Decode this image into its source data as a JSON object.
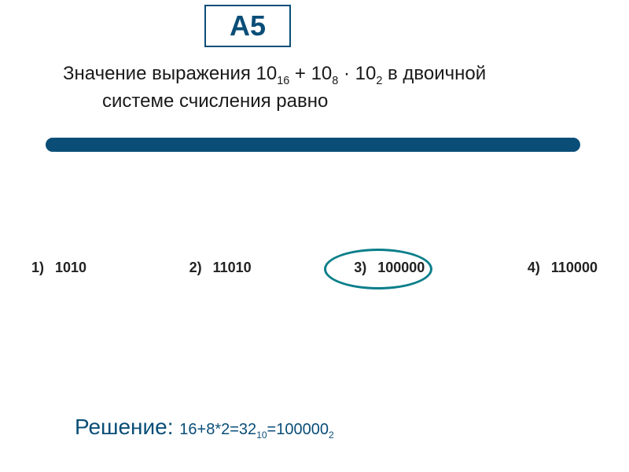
{
  "badge": "А5",
  "question": {
    "line1_pre": "Значение выражения 10",
    "sub1": "16",
    "line1_mid1": " + 10",
    "sub2": "8",
    "line1_mid2": " · 10",
    "sub3": "2",
    "line1_post": " в двоичной",
    "line2": "системе счисления равно"
  },
  "options": [
    {
      "num": "1)",
      "val": "1010"
    },
    {
      "num": "2)",
      "val": "11010"
    },
    {
      "num": "3)",
      "val": "100000"
    },
    {
      "num": "4)",
      "val": "110000"
    }
  ],
  "correct_index": 2,
  "solution": {
    "label": "Решение: ",
    "expr_pre": "16+8*2=32",
    "sub1": "10",
    "expr_mid": "=100000",
    "sub2": "2"
  },
  "chart_data": {
    "type": "table",
    "title": "Multiple-choice answers",
    "categories": [
      "1",
      "2",
      "3",
      "4"
    ],
    "values": [
      "1010",
      "11010",
      "100000",
      "110000"
    ],
    "correct": "3"
  }
}
